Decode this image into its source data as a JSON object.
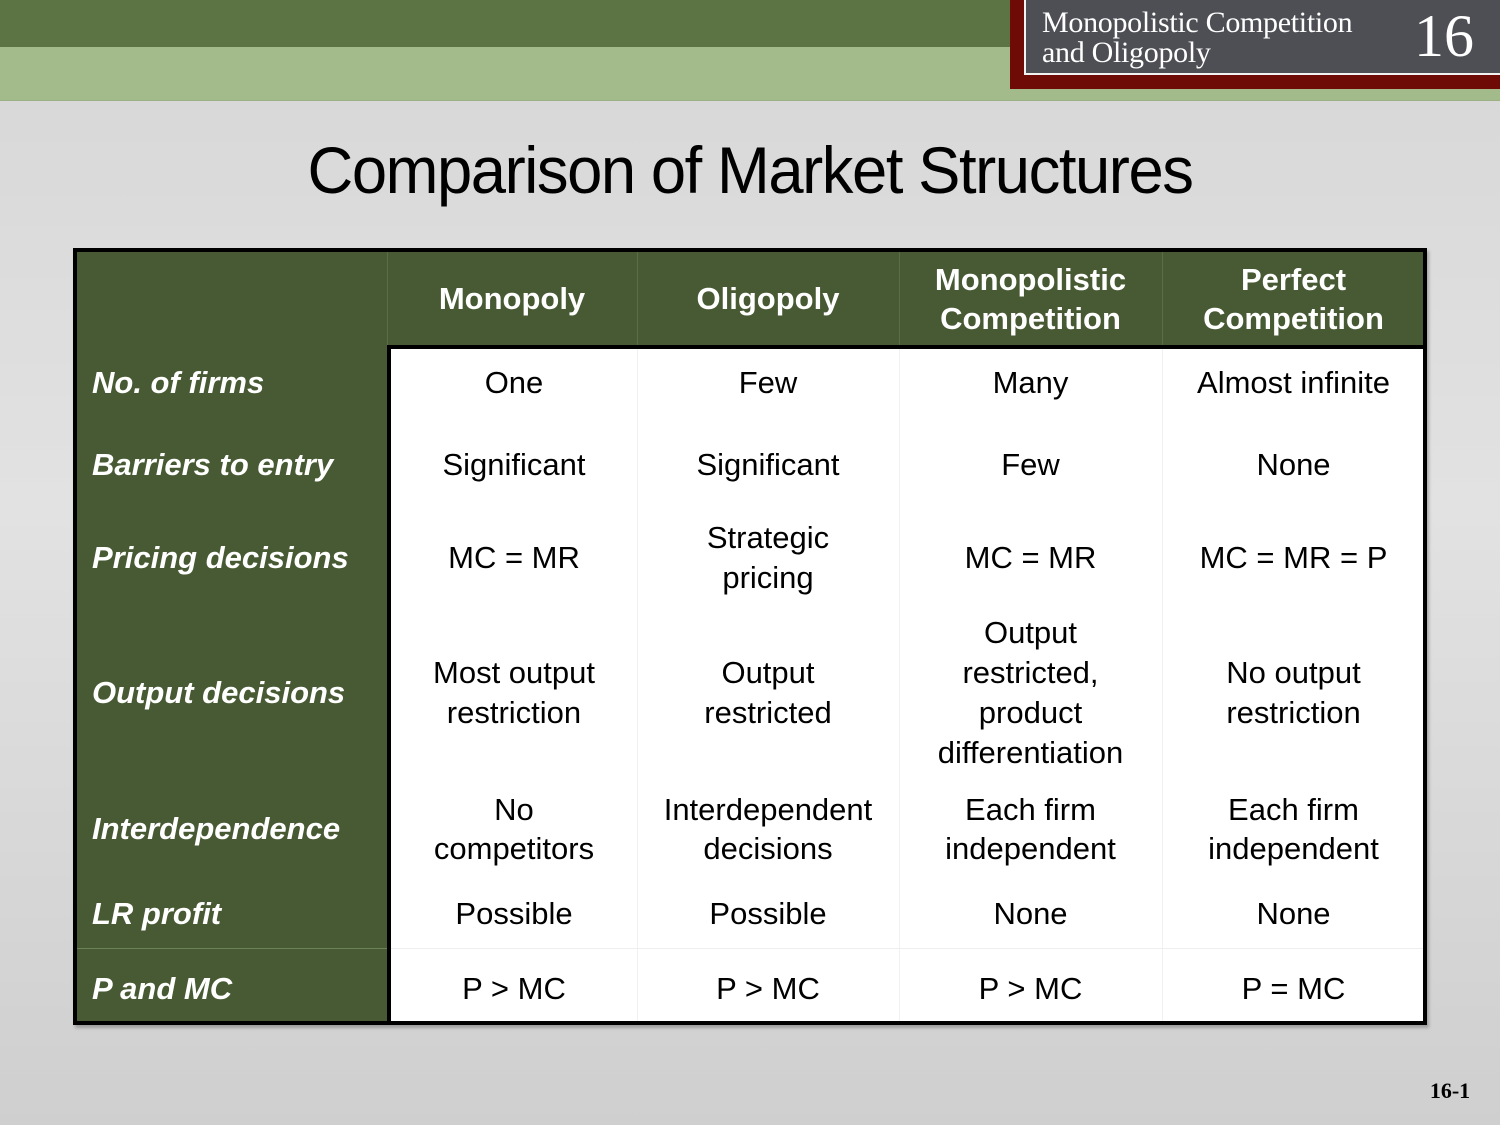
{
  "header": {
    "chapter_title_line1": "Monopolistic Competition",
    "chapter_title_line2": "and Oligopoly",
    "chapter_number": "16",
    "colors": {
      "dark_band": "#5c7444",
      "light_band": "#a3bb8a",
      "chapter_frame": "#6e0b07",
      "chapter_box": "#4e4f54"
    }
  },
  "slide": {
    "title": "Comparison of Market Structures",
    "page_number": "16-1"
  },
  "table": {
    "colors": {
      "header_bg": "#475a33",
      "body_bg": "#ffffff",
      "border": "#000000"
    },
    "columns": [
      {
        "label": "Monopoly"
      },
      {
        "label": "Oligopoly"
      },
      {
        "label": "Monopolistic\nCompetition"
      },
      {
        "label": "Perfect\nCompetition"
      }
    ],
    "rows": [
      {
        "label": "No. of firms",
        "cells": [
          "One",
          "Few",
          "Many",
          "Almost infinite"
        ]
      },
      {
        "label": "Barriers to entry",
        "cells": [
          "Significant",
          "Significant",
          "Few",
          "None"
        ]
      },
      {
        "label": "Pricing decisions",
        "cells": [
          "MC = MR",
          "Strategic\npricing",
          "MC = MR",
          "MC = MR = P"
        ]
      },
      {
        "label": "Output decisions",
        "cells": [
          "Most output\nrestriction",
          "Output\nrestricted",
          "Output\nrestricted,\nproduct\ndifferentiation",
          "No output\nrestriction"
        ]
      },
      {
        "label": "Interdependence",
        "cells": [
          "No\ncompetitors",
          "Interdependent\ndecisions",
          "Each firm\nindependent",
          "Each firm\nindependent"
        ]
      },
      {
        "label": "LR profit",
        "cells": [
          "Possible",
          "Possible",
          "None",
          "None"
        ]
      },
      {
        "label": "P and MC",
        "cells": [
          "P > MC",
          "P > MC",
          "P > MC",
          "P = MC"
        ]
      }
    ]
  }
}
